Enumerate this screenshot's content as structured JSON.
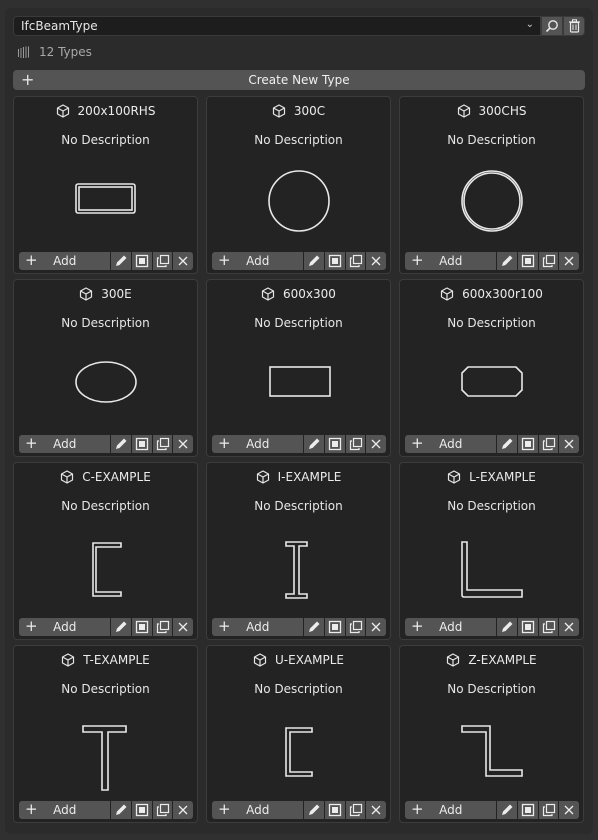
{
  "header": {
    "class_selector": {
      "value": "IfcBeamType"
    },
    "search_button": {
      "icon": "search-icon"
    },
    "purge_button": {
      "icon": "trash-icon"
    }
  },
  "summary": {
    "icon": "type-stack-icon",
    "count_label": "12 Types"
  },
  "create_button": {
    "icon": "plus-icon",
    "label": "Create New Type"
  },
  "card_actions": {
    "add_label": "Add",
    "icons": [
      "plus-icon",
      "pencil-icon",
      "select-icon",
      "duplicate-icon",
      "close-icon"
    ]
  },
  "types": [
    {
      "name": "200x100RHS",
      "description": "No Description",
      "profile": "rhs"
    },
    {
      "name": "300C",
      "description": "No Description",
      "profile": "circle"
    },
    {
      "name": "300CHS",
      "description": "No Description",
      "profile": "chs"
    },
    {
      "name": "300E",
      "description": "No Description",
      "profile": "ellipse"
    },
    {
      "name": "600x300",
      "description": "No Description",
      "profile": "rect"
    },
    {
      "name": "600x300r100",
      "description": "No Description",
      "profile": "rounded-rect"
    },
    {
      "name": "C-EXAMPLE",
      "description": "No Description",
      "profile": "c"
    },
    {
      "name": "I-EXAMPLE",
      "description": "No Description",
      "profile": "i"
    },
    {
      "name": "L-EXAMPLE",
      "description": "No Description",
      "profile": "l"
    },
    {
      "name": "T-EXAMPLE",
      "description": "No Description",
      "profile": "t"
    },
    {
      "name": "U-EXAMPLE",
      "description": "No Description",
      "profile": "u"
    },
    {
      "name": "Z-EXAMPLE",
      "description": "No Description",
      "profile": "z"
    }
  ]
}
